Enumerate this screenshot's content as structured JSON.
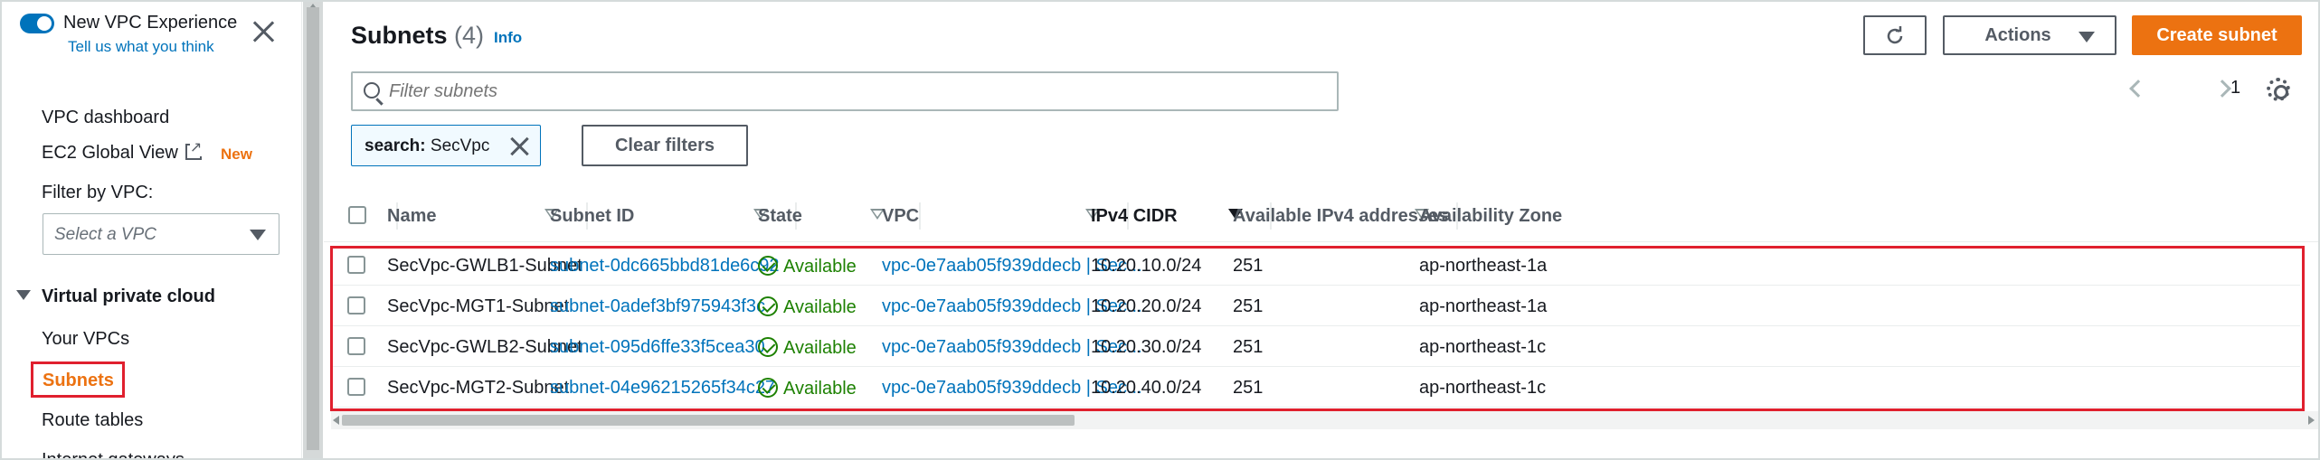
{
  "sidebar": {
    "new_vpc_label": "New VPC Experience",
    "feedback_link": "Tell us what you think",
    "links": {
      "vpc_dashboard": "VPC dashboard",
      "ec2_global_view": "EC2 Global View",
      "new_badge": "New",
      "filter_by_vpc": "Filter by VPC:",
      "select_placeholder": "Select a VPC",
      "section_title": "Virtual private cloud",
      "your_vpcs": "Your VPCs",
      "subnets": "Subnets",
      "route_tables": "Route tables",
      "internet_gateways": "Internet gateways"
    }
  },
  "header": {
    "title": "Subnets",
    "count": "(4)",
    "info": "Info",
    "actions": "Actions",
    "create": "Create subnet",
    "search_placeholder": "Filter subnets",
    "page": "1",
    "filter_token_key": "search:",
    "filter_token_value": "SecVpc",
    "clear_filters": "Clear filters"
  },
  "table": {
    "columns": [
      "Name",
      "Subnet ID",
      "State",
      "VPC",
      "IPv4 CIDR",
      "Available IPv4 addresses",
      "Availability Zone"
    ],
    "rows": [
      {
        "name": "SecVpc-GWLB1-Subnet",
        "subnet_id": "subnet-0dc665bbd81de6c92",
        "state": "Available",
        "vpc": "vpc-0e7aab05f939ddecb | Sec...",
        "cidr": "10.20.10.0/24",
        "available": "251",
        "az": "ap-northeast-1a"
      },
      {
        "name": "SecVpc-MGT1-Subnet",
        "subnet_id": "subnet-0adef3bf975943f3c",
        "state": "Available",
        "vpc": "vpc-0e7aab05f939ddecb | Sec...",
        "cidr": "10.20.20.0/24",
        "available": "251",
        "az": "ap-northeast-1a"
      },
      {
        "name": "SecVpc-GWLB2-Subnet",
        "subnet_id": "subnet-095d6ffe33f5cea30",
        "state": "Available",
        "vpc": "vpc-0e7aab05f939ddecb | Sec...",
        "cidr": "10.20.30.0/24",
        "available": "251",
        "az": "ap-northeast-1c"
      },
      {
        "name": "SecVpc-MGT2-Subnet",
        "subnet_id": "subnet-04e96215265f34c27",
        "state": "Available",
        "vpc": "vpc-0e7aab05f939ddecb | Sec...",
        "cidr": "10.20.40.0/24",
        "available": "251",
        "az": "ap-northeast-1c"
      }
    ]
  },
  "colors": {
    "accent": "#0073bb",
    "primary_button": "#ec7211",
    "available": "#1d8102",
    "highlight": "#e0202e"
  }
}
